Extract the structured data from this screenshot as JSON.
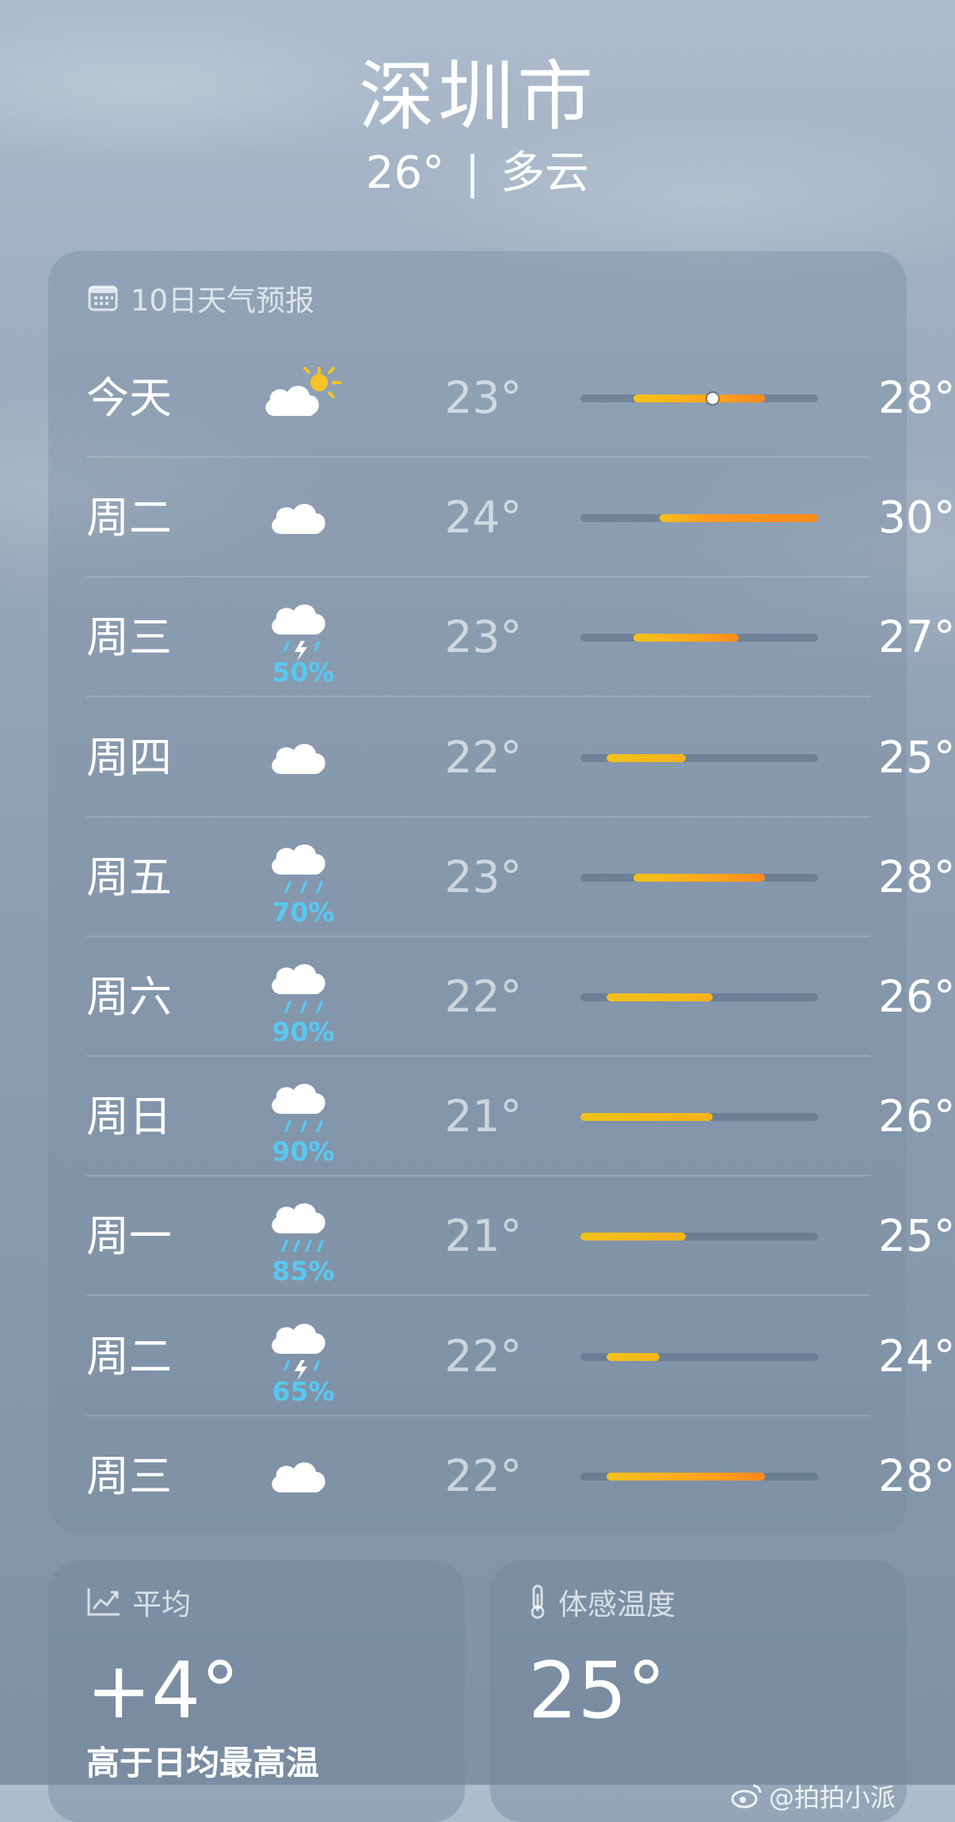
{
  "header": {
    "city": "深圳市",
    "current_temp": "26°",
    "separator": "|",
    "condition": "多云"
  },
  "forecast": {
    "title": "10日天气预报",
    "title_icon": "calendar-icon",
    "scale_min": 21,
    "scale_max": 30,
    "days": [
      {
        "day": "今天",
        "icon": "partly-sunny-icon",
        "precip": "",
        "low": "23°",
        "high": "28°",
        "low_v": 23,
        "high_v": 28,
        "now_v": 26
      },
      {
        "day": "周二",
        "icon": "cloud-icon",
        "precip": "",
        "low": "24°",
        "high": "30°",
        "low_v": 24,
        "high_v": 30
      },
      {
        "day": "周三",
        "icon": "thunderstorm-icon",
        "precip": "50%",
        "low": "23°",
        "high": "27°",
        "low_v": 23,
        "high_v": 27
      },
      {
        "day": "周四",
        "icon": "cloud-icon",
        "precip": "",
        "low": "22°",
        "high": "25°",
        "low_v": 22,
        "high_v": 25
      },
      {
        "day": "周五",
        "icon": "drizzle-icon",
        "precip": "70%",
        "low": "23°",
        "high": "28°",
        "low_v": 23,
        "high_v": 28
      },
      {
        "day": "周六",
        "icon": "rain-icon",
        "precip": "90%",
        "low": "22°",
        "high": "26°",
        "low_v": 22,
        "high_v": 26
      },
      {
        "day": "周日",
        "icon": "rain-icon",
        "precip": "90%",
        "low": "21°",
        "high": "26°",
        "low_v": 21,
        "high_v": 26
      },
      {
        "day": "周一",
        "icon": "heavy-rain-icon",
        "precip": "85%",
        "low": "21°",
        "high": "25°",
        "low_v": 21,
        "high_v": 25
      },
      {
        "day": "周二",
        "icon": "thunderstorm-icon",
        "precip": "65%",
        "low": "22°",
        "high": "24°",
        "low_v": 22,
        "high_v": 24
      },
      {
        "day": "周三",
        "icon": "cloud-icon",
        "precip": "",
        "low": "22°",
        "high": "28°",
        "low_v": 22,
        "high_v": 28
      }
    ]
  },
  "averages": {
    "label": "平均",
    "icon": "trend-chart-icon",
    "value": "+4°",
    "description": "高于日均最高温"
  },
  "feels_like": {
    "label": "体感温度",
    "icon": "thermometer-icon",
    "value": "25°"
  },
  "watermark": "@拍拍小派",
  "colors": {
    "precip": "#58c8f2",
    "bar_cool": "#f2c21b",
    "bar_warm": "#ff8a1c"
  }
}
